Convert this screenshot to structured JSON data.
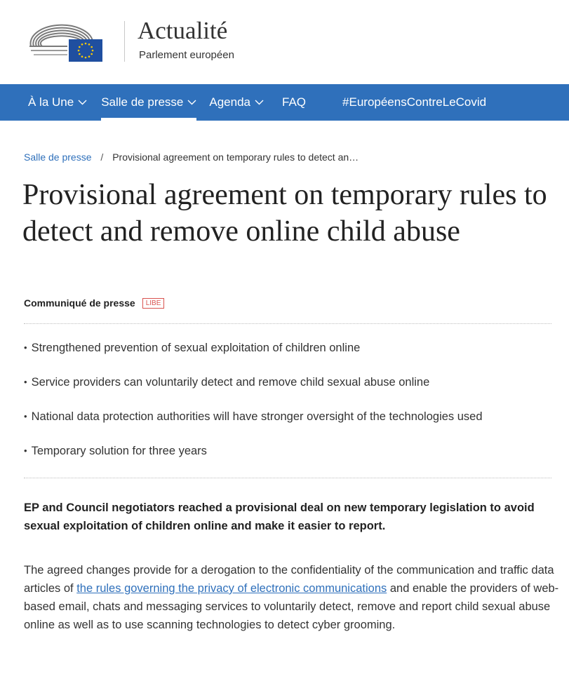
{
  "header": {
    "title": "Actualité",
    "subtitle": "Parlement européen",
    "logo_icon": "european-parliament-logo",
    "colors": {
      "eu_blue": "#1f4fa0",
      "eu_star": "#ffcc00"
    }
  },
  "nav": {
    "items": [
      {
        "label": "À la Une",
        "has_dropdown": true,
        "active": false
      },
      {
        "label": "Salle de presse",
        "has_dropdown": true,
        "active": true
      },
      {
        "label": "Agenda",
        "has_dropdown": true,
        "active": false
      },
      {
        "label": "FAQ",
        "has_dropdown": false,
        "active": false
      },
      {
        "label": "#EuropéensContreLeCovid",
        "has_dropdown": false,
        "active": false
      }
    ],
    "colors": {
      "background": "#2f70bb",
      "text": "#ffffff"
    }
  },
  "breadcrumb": {
    "root": "Salle de presse",
    "separator": "/",
    "current": "Provisional agreement on temporary rules to detect an…"
  },
  "article": {
    "headline": "Provisional agreement on temporary rules to detect and remove online child abuse",
    "type_label": "Communiqué de presse",
    "committee_badge": "LIBE",
    "bullets": [
      "Strengthened prevention of sexual exploitation of children online",
      "Service providers can voluntarily detect and remove child sexual abuse online",
      "National data protection authorities will have stronger oversight of the technologies used",
      "Temporary solution for three years"
    ],
    "lead": "EP and Council negotiators reached a provisional deal on new temporary legislation to avoid sexual exploitation of children online and make it easier to report.",
    "body_before_link": "The agreed changes provide for a derogation to the confidentiality of the communication and traffic data articles of ",
    "body_link": "the rules governing the privacy of electronic communications",
    "body_after_link": " and enable the providers of web-based email, chats and messaging services to voluntarily detect, remove and report child sexual abuse online as well as to use scanning technologies to detect cyber grooming."
  }
}
